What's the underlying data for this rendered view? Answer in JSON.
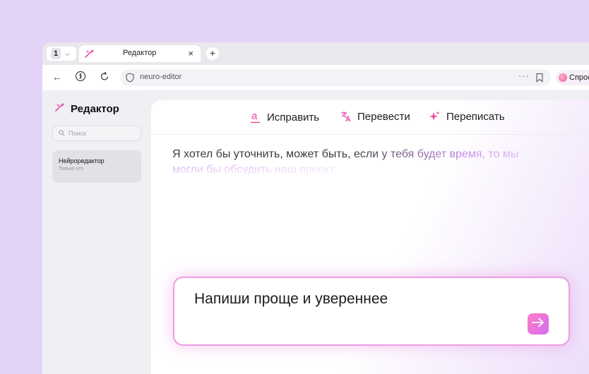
{
  "browser": {
    "tab_count": "1",
    "tab_title": "Редактор",
    "tab_close": "×",
    "new_tab": "+",
    "url": "neuro-editor",
    "menu_dots": "···",
    "ask_label": "Спрос"
  },
  "sidebar": {
    "title": "Редактор",
    "search_placeholder": "Поиск",
    "history": [
      {
        "title": "Нейроредактор",
        "time": "Только что"
      }
    ]
  },
  "toolbar": {
    "fix_label": "Исправить",
    "translate_label": "Перевести",
    "rewrite_label": "Переписать"
  },
  "editor": {
    "line1": "Я хотел бы уточнить, может быть, если у тебя будет время, то мы",
    "line2": "могли бы обсудить наш проект"
  },
  "prompt": {
    "text": "Напиши проще и увереннее"
  },
  "colors": {
    "page_background": "#e2d3f7",
    "accent_pink": "#e84aa8",
    "send_gradient": [
      "#ff7fc8",
      "#d46cf0"
    ]
  }
}
